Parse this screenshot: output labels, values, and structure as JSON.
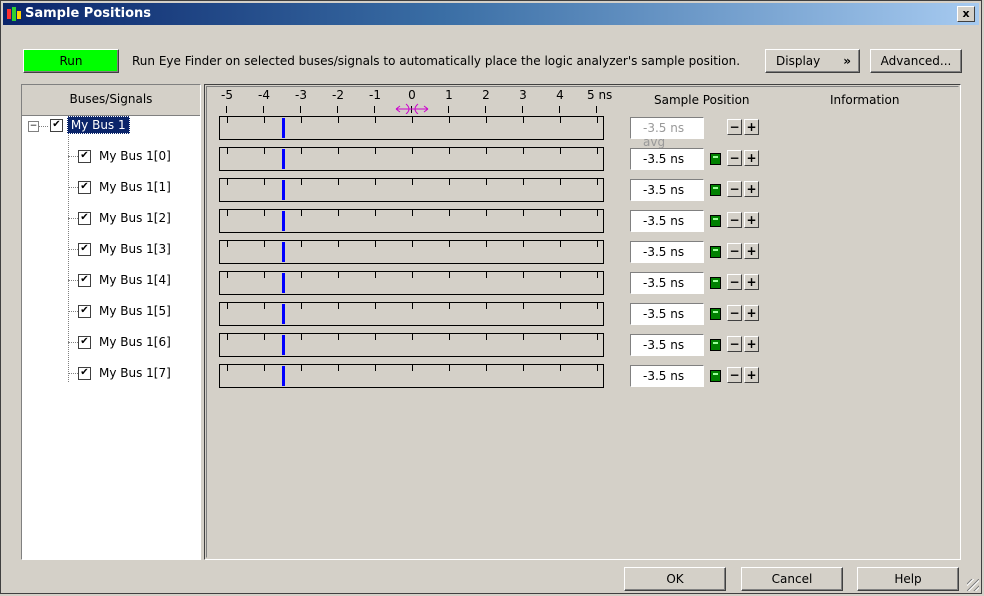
{
  "window": {
    "title": "Sample Positions",
    "close_label": "x"
  },
  "toolbar": {
    "run_label": "Run",
    "info_text": "Run Eye Finder on selected buses/signals to automatically place the logic analyzer's sample position.",
    "display_label": "Display",
    "display_chevron": "»",
    "advanced_label": "Advanced..."
  },
  "left": {
    "header": "Buses/Signals",
    "root": {
      "label": "My Bus 1",
      "checked": "✔",
      "expander": "−"
    },
    "signals": [
      {
        "label": "My Bus 1[0]",
        "checked": "✔"
      },
      {
        "label": "My Bus 1[1]",
        "checked": "✔"
      },
      {
        "label": "My Bus 1[2]",
        "checked": "✔"
      },
      {
        "label": "My Bus 1[3]",
        "checked": "✔"
      },
      {
        "label": "My Bus 1[4]",
        "checked": "✔"
      },
      {
        "label": "My Bus 1[5]",
        "checked": "✔"
      },
      {
        "label": "My Bus 1[6]",
        "checked": "✔"
      },
      {
        "label": "My Bus 1[7]",
        "checked": "✔"
      }
    ]
  },
  "main": {
    "ruler_labels": [
      "-5",
      "-4",
      "-3",
      "-2",
      "-1",
      "0",
      "1",
      "2",
      "3",
      "4",
      "5 ns"
    ],
    "ruler_min": -5,
    "ruler_max": 5,
    "sample_position_header": "Sample Position",
    "information_header": "Information",
    "root_position": "-3.5 ns avg",
    "root_position_value": -3.5,
    "signal_positions": [
      "-3.5 ns",
      "-3.5 ns",
      "-3.5 ns",
      "-3.5 ns",
      "-3.5 ns",
      "-3.5 ns",
      "-3.5 ns",
      "-3.5 ns"
    ],
    "signal_position_values": [
      -3.5,
      -3.5,
      -3.5,
      -3.5,
      -3.5,
      -3.5,
      -3.5,
      -3.5
    ],
    "minus_label": "−",
    "plus_label": "+"
  },
  "footer": {
    "ok_label": "OK",
    "cancel_label": "Cancel",
    "help_label": "Help"
  },
  "colors": {
    "run_button": "#00ff00",
    "marker": "#0000ff",
    "selection": "#0a246a",
    "center_marker": "#cc00cc"
  }
}
